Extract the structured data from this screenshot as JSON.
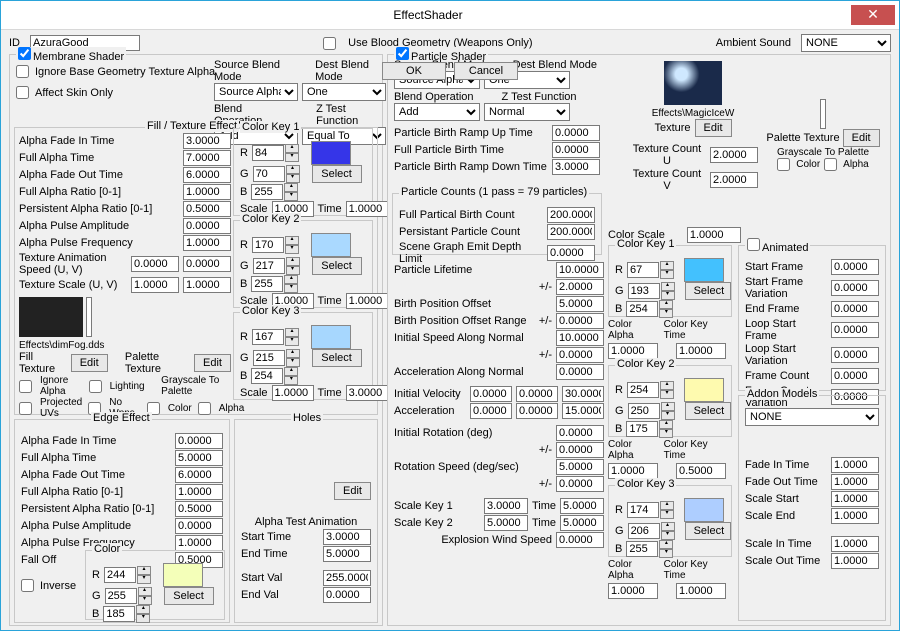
{
  "window_title": "EffectShader",
  "top": {
    "id_label": "ID",
    "id_value": "AzuraGood",
    "ubg_label": "Use Blood Geometry (Weapons Only)",
    "ubg_checked": false,
    "ambient_label": "Ambient Sound",
    "ambient_value": "NONE"
  },
  "membrane": {
    "legend": "Membrane Shader",
    "checked": true,
    "ignore_base": "Ignore Base Geometry Texture Alpha",
    "affect_skin": "Affect Skin Only",
    "sbm_label": "Source Blend Mode",
    "sbm_value": "Source Alpha",
    "dbm_label": "Dest Blend Mode",
    "dbm_value": "One",
    "bo_label": "Blend Operation",
    "bo_value": "Add",
    "zt_label": "Z Test Function",
    "zt_value": "Equal To"
  },
  "fte": {
    "legend": "Fill / Texture Effect",
    "rows": {
      "afit": "Alpha Fade In Time",
      "afit_v": "3.0000",
      "fat": "Full Alpha Time",
      "fat_v": "7.0000",
      "afot": "Alpha Fade Out Time",
      "afot_v": "6.0000",
      "far": "Full Alpha Ratio [0-1]",
      "far_v": "1.0000",
      "par": "Persistent Alpha Ratio [0-1]",
      "par_v": "0.5000",
      "apa": "Alpha Pulse Amplitude",
      "apa_v": "0.0000",
      "apf": "Alpha Pulse Frequency",
      "apf_v": "1.0000",
      "tas": "Texture Animation Speed (U, V)",
      "tas_u": "0.0000",
      "tas_v": "0.0000",
      "ts": "Texture Scale (U, V)",
      "ts_u": "1.0000",
      "ts_v": "1.0000"
    },
    "fill_tex": "Effects\\dimFog.dds",
    "fill_tex_lbl": "Fill Texture",
    "edit": "Edit",
    "pal_tex_lbl": "Palette Texture",
    "ig_alpha": "Ignore Alpha",
    "lighting": "Lighting",
    "proj_uv": "Projected UVs",
    "no_wpns": "No Wpns",
    "gray_pal": "Grayscale To Palette",
    "color": "Color",
    "alpha": "Alpha",
    "ck1": {
      "legend": "Color Key 1",
      "r": "84",
      "g": "70",
      "b": "255",
      "scale": "1.0000",
      "time": "1.0000",
      "swatch": "#3535e8",
      "select": "Select"
    },
    "ck2": {
      "legend": "Color Key 2",
      "r": "170",
      "g": "217",
      "b": "255",
      "scale": "1.0000",
      "time": "1.0000",
      "swatch": "#aad9ff"
    },
    "ck3": {
      "legend": "Color Key 3",
      "r": "167",
      "g": "215",
      "b": "254",
      "scale": "1.0000",
      "time": "3.0000",
      "swatch": "#a7d7fe"
    },
    "R": "R",
    "G": "G",
    "B": "B",
    "Scale": "Scale",
    "Time": "Time"
  },
  "edge": {
    "legend": "Edge Effect",
    "afit": "Alpha Fade In Time",
    "afit_v": "0.0000",
    "fat": "Full Alpha Time",
    "fat_v": "5.0000",
    "afot": "Alpha Fade Out Time",
    "afot_v": "6.0000",
    "far": "Full Alpha Ratio [0-1]",
    "far_v": "1.0000",
    "par": "Persistent Alpha Ratio [0-1]",
    "par_v": "0.5000",
    "apa": "Alpha Pulse Amplitude",
    "apa_v": "0.0000",
    "apf": "Alpha Pulse Frequency",
    "apf_v": "1.0000",
    "fall": "Fall Off",
    "fall_v": "0.5000",
    "inverse": "Inverse",
    "color": {
      "legend": "Color",
      "r": "244",
      "g": "255",
      "b": "185",
      "swatch": "#f4ffb9",
      "select": "Select"
    }
  },
  "holes": {
    "legend": "Holes",
    "edit": "Edit",
    "ata_legend": "Alpha Test Animation",
    "st": "Start Time",
    "st_v": "3.0000",
    "et": "End Time",
    "et_v": "5.0000",
    "sv": "Start Val",
    "sv_v": "255.0000",
    "ev": "End Val",
    "ev_v": "0.0000"
  },
  "particle": {
    "legend": "Particle Shader",
    "checked": true,
    "sbm_label": "Source Blend Mode",
    "sbm_value": "Source Alpha",
    "dbm_label": "Dest Blend Mode",
    "dbm_value": "One",
    "bo_label": "Blend Operation",
    "bo_value": "Add",
    "zt_label": "Z Test Function",
    "zt_value": "Normal",
    "pbru": "Particle Birth Ramp Up Time",
    "pbru_v": "0.0000",
    "fpbt": "Full Particle Birth Time",
    "fpbt_v": "0.0000",
    "pbrd": "Particle Birth Ramp Down Time",
    "pbrd_v": "3.0000",
    "pc_legend": "Particle Counts (1 pass = 79 particles)",
    "fpbc": "Full Partical Birth Count",
    "fpbc_v": "200.0000",
    "ppc": "Persistant Particle Count",
    "ppc_v": "200.0000",
    "sgedl": "Scene Graph Emit Depth Limit",
    "sgedl_v": "0.0000",
    "pl": "Particle Lifetime",
    "pl_v": "10.0000",
    "pl_pm": "2.0000",
    "bpo": "Birth Position Offset",
    "bpo_v": "5.0000",
    "bpor": "Birth Position Offset Range",
    "bpor_v": "0.0000",
    "isan": "Initial Speed Along Normal",
    "isan_v": "10.0000",
    "isan_pm": "0.0000",
    "aan": "Acceleration Along Normal",
    "aan_v": "0.0000",
    "iv": "Initial Velocity",
    "iv1": "0.0000",
    "iv2": "0.0000",
    "iv3": "30.0000",
    "acc": "Acceleration",
    "acc1": "0.0000",
    "acc2": "0.0000",
    "acc3": "15.0000",
    "ir": "Initial Rotation (deg)",
    "ir_v": "0.0000",
    "ir_pm": "0.0000",
    "rs": "Rotation Speed (deg/sec)",
    "rs_v": "5.0000",
    "rs_pm": "0.0000",
    "sk1": "Scale Key 1",
    "sk1_v": "3.0000",
    "sk1_t": "5.0000",
    "sk2": "Scale Key 2",
    "sk2_v": "5.0000",
    "sk2_t": "5.0000",
    "ews": "Explosion Wind Speed",
    "ews_v": "0.0000",
    "time": "Time",
    "pm": "+/-",
    "tex_path": "Effects\\MagicIceW",
    "texture": "Texture",
    "edit": "Edit",
    "tcu": "Texture Count U",
    "tcu_v": "2.0000",
    "tcv": "Texture Count V",
    "tcv_v": "2.0000",
    "cs": "Color Scale",
    "cs_v": "1.0000",
    "ck1": {
      "legend": "Color Key 1",
      "r": "67",
      "g": "193",
      "b": "254",
      "swatch": "#43c1fe",
      "ca": "1.0000",
      "ckt": "1.0000"
    },
    "ck2": {
      "legend": "Color Key 2",
      "r": "254",
      "g": "250",
      "b": "175",
      "swatch": "#fefaaf",
      "ca": "1.0000",
      "ckt": "0.5000"
    },
    "ck3": {
      "legend": "Color Key 3",
      "r": "174",
      "g": "206",
      "b": "255",
      "swatch": "#aeceff",
      "ca": "1.0000",
      "ckt": "1.0000"
    },
    "ca_lbl": "Color Alpha",
    "ckt_lbl": "Color Key Time",
    "select": "Select",
    "paltex": "Palette Texture",
    "gray": "Grayscale To Palette",
    "color": "Color",
    "alpha": "Alpha"
  },
  "animated": {
    "legend": "Animated",
    "sf": "Start Frame",
    "sf_v": "0.0000",
    "sfv": "Start Frame Variation",
    "sfv_v": "0.0000",
    "ef": "End Frame",
    "ef_v": "0.0000",
    "lsf": "Loop Start Frame",
    "lsf_v": "0.0000",
    "lsv": "Loop Start Variation",
    "lsv_v": "0.0000",
    "fc": "Frame Count",
    "fc_v": "0.0000",
    "fcv": "Frame Count Variation",
    "fcv_v": "0.0000"
  },
  "addon": {
    "legend": "Addon Models",
    "none": "NONE",
    "fit": "Fade In Time",
    "fit_v": "1.0000",
    "fot": "Fade Out Time",
    "fot_v": "1.0000",
    "ss": "Scale Start",
    "ss_v": "1.0000",
    "se": "Scale End",
    "se_v": "1.0000",
    "sit": "Scale In Time",
    "sit_v": "1.0000",
    "sot": "Scale Out Time",
    "sot_v": "1.0000"
  },
  "footer": {
    "ok": "OK",
    "cancel": "Cancel"
  }
}
